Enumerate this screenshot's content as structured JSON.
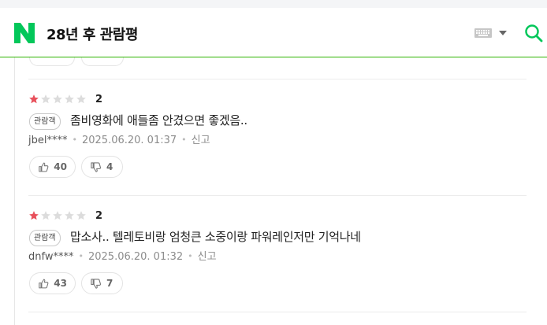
{
  "header": {
    "title": "28년 후 관람평",
    "logo_icon": "naver-n-logo",
    "keyboard_icon": "keyboard-icon",
    "search_icon": "search-icon",
    "brand_color": "#03c75a"
  },
  "reviews": [
    {
      "rating": 1,
      "max_rating": 5,
      "score": "2",
      "badge": "관람객",
      "text": "좀비영화에 애들좀 안겼으면 좋겠음..",
      "user": "jbel****",
      "date": "2025.06.20. 01:37",
      "report": "신고",
      "likes": "40",
      "dislikes": "4"
    },
    {
      "rating": 1,
      "max_rating": 5,
      "score": "2",
      "badge": "관람객",
      "text": "맙소사.. 텔레토비랑 엄청큰 소중이랑 파워레인저만 기억나네",
      "user": "dnfw****",
      "date": "2025.06.20. 01:32",
      "report": "신고",
      "likes": "43",
      "dislikes": "7"
    }
  ],
  "colors": {
    "star_filled": "#e8505b",
    "star_empty": "#dcdcdc"
  }
}
